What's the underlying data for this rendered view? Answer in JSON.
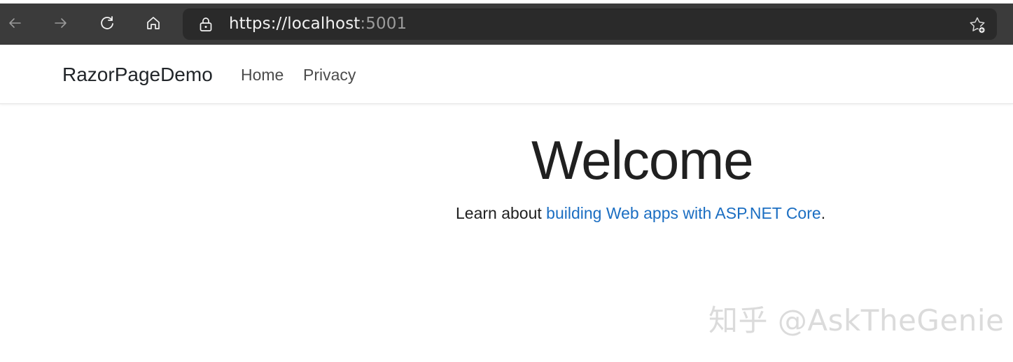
{
  "browser": {
    "url_prefix": "https://",
    "url_host": "localhost",
    "url_port": ":5001"
  },
  "site": {
    "brand": "RazorPageDemo",
    "nav": {
      "home": "Home",
      "privacy": "Privacy"
    }
  },
  "main": {
    "title": "Welcome",
    "lead_text": "Learn about",
    "lead_link": "building Web apps with ASP.NET Core",
    "lead_end": "."
  },
  "watermark": "知乎 @AskTheGenie",
  "icons": {
    "back": "back-arrow-icon",
    "forward": "forward-arrow-icon",
    "refresh": "refresh-icon",
    "home": "home-icon",
    "lock": "lock-icon",
    "favorites": "favorites-star-icon"
  }
}
